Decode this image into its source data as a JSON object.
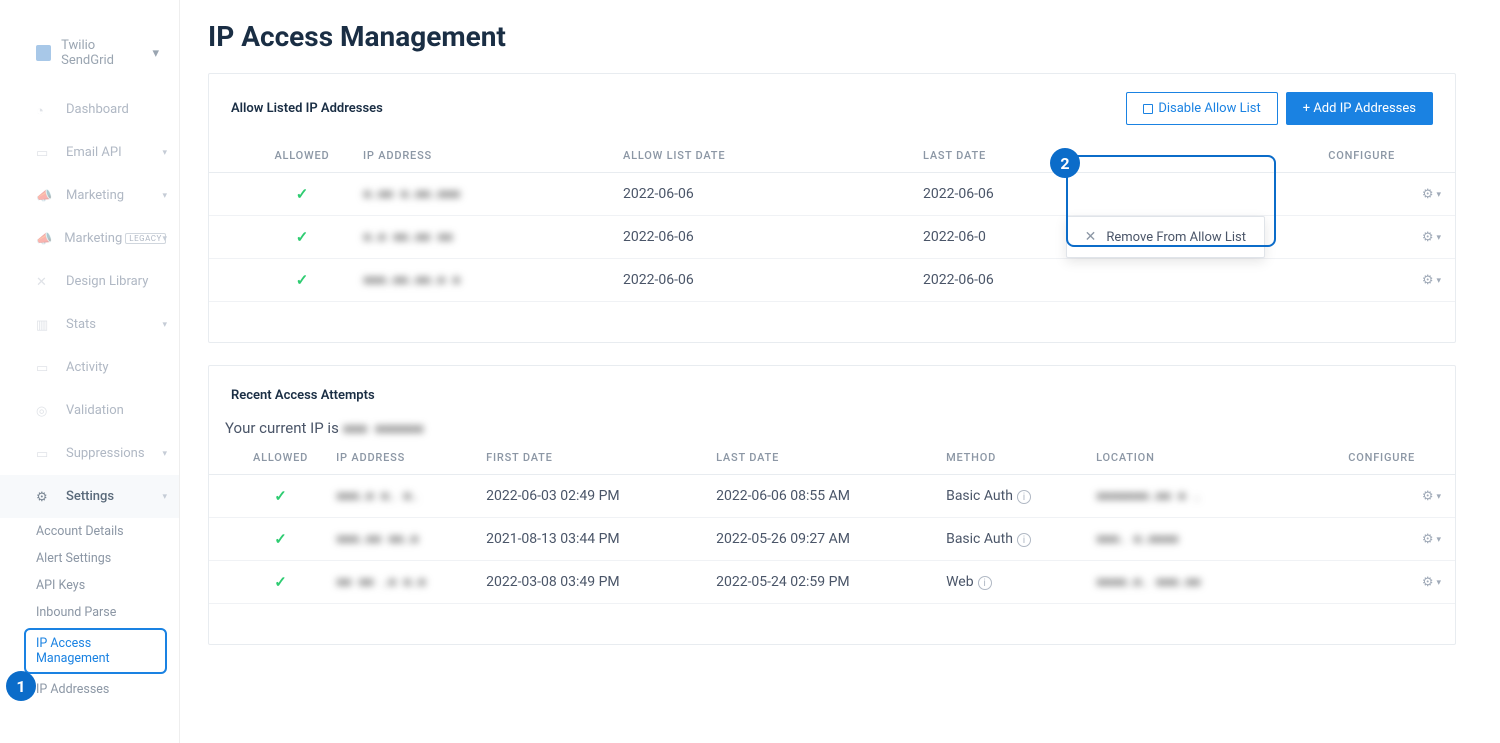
{
  "brand": "Twilio SendGrid",
  "nav": {
    "dashboard": "Dashboard",
    "email_api": "Email API",
    "marketing": "Marketing",
    "marketing_legacy": "Marketing",
    "legacy_badge": "LEGACY",
    "design_library": "Design Library",
    "stats": "Stats",
    "activity": "Activity",
    "validation": "Validation",
    "suppressions": "Suppressions",
    "settings": "Settings",
    "sub": {
      "account_details": "Account Details",
      "alert_settings": "Alert Settings",
      "api_keys": "API Keys",
      "inbound_parse": "Inbound Parse",
      "ip_access": "IP Access Management",
      "ip_addresses": "IP Addresses"
    }
  },
  "page": {
    "title": "IP Access Management",
    "allow_panel_title": "Allow Listed IP Addresses",
    "disable_btn": "Disable Allow List",
    "add_btn": "+ Add IP Addresses",
    "dropdown_item": "Remove From Allow List",
    "recent_title": "Recent Access Attempts",
    "current_ip_label": "Your current IP is",
    "current_ip": "▪▪▪ ▪▪▪▪▪▪"
  },
  "allow_headers": {
    "allowed": "ALLOWED",
    "ip": "IP ADDRESS",
    "list_date": "ALLOW LIST DATE",
    "last_date": "LAST DATE",
    "configure": "CONFIGURE"
  },
  "allow_rows": [
    {
      "ip": "▪.▪▪ ▪.▪▪.▪▪▪",
      "list_date": "2022-06-06",
      "last_date": "2022-06-06"
    },
    {
      "ip": "▪.▪  ▪▪.▪▪ ▪▪",
      "list_date": "2022-06-06",
      "last_date": "2022-06-0"
    },
    {
      "ip": "▪▪▪.▪▪.▪▪.▪ ▪",
      "list_date": "2022-06-06",
      "last_date": "2022-06-06"
    }
  ],
  "recent_headers": {
    "allowed": "ALLOWED",
    "ip": "IP ADDRESS",
    "first": "FIRST DATE",
    "last": "LAST DATE",
    "method": "METHOD",
    "location": "LOCATION",
    "configure": "CONFIGURE"
  },
  "recent_rows": [
    {
      "ip": "▪▪▪.▪ ▪. ▪.",
      "first": "2022-06-03 02:49 PM",
      "last": "2022-06-06 08:55 AM",
      "method": "Basic Auth",
      "location": "▪▪▪▪▪▪▪.▪▪ ▪ ."
    },
    {
      "ip": "▪▪▪.▪▪ ▪▪.▪",
      "first": "2021-08-13 03:44 PM",
      "last": "2022-05-26 09:27 AM",
      "method": "Basic Auth",
      "location": "▪▪▪.    ▪.▪▪▪▪"
    },
    {
      "ip": "▪▪ ▪▪ .▪ ▪.▪",
      "first": "2022-03-08 03:49 PM",
      "last": "2022-05-24 02:59 PM",
      "method": "Web",
      "location": "▪▪▪▪.▪. ▪▪▪.▪▪"
    }
  ],
  "callouts": {
    "one": "1",
    "two": "2"
  }
}
